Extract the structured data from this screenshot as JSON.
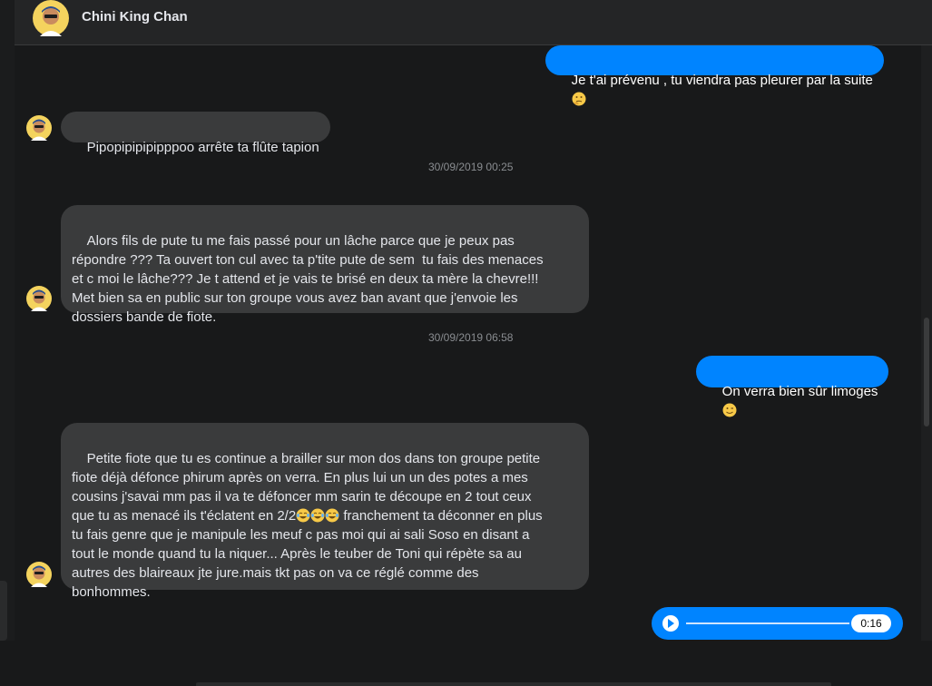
{
  "header": {
    "contact_name": "Chini King Chan"
  },
  "messages": [
    {
      "kind": "outgoing",
      "text": "Je t'ai prévenu , tu viendra pas pleurer par la suite",
      "emoji": "thinking-face"
    },
    {
      "kind": "incoming",
      "text": "Pipopipipipipppoo arrête ta flûte tapion"
    },
    {
      "kind": "timestamp",
      "text": "30/09/2019 00:25"
    },
    {
      "kind": "incoming",
      "text": "Alors fils de pute tu me fais passé pour un lâche parce que je peux pas\nrépondre ??? Ta ouvert ton cul avec ta p'tite pute de sem  tu fais des menaces\net c moi le lâche??? Je t attend et je vais te brisé en deux ta mère la chevre!!!\nMet bien sa en public sur ton groupe vous avez ban avant que j'envoie les\ndossiers bande de fiote."
    },
    {
      "kind": "timestamp",
      "text": "30/09/2019 06:58"
    },
    {
      "kind": "outgoing",
      "text": "On verra bien sûr limoges",
      "emoji": "winking-face"
    },
    {
      "kind": "incoming",
      "text_before": "Petite fiote que tu es continue a brailler sur mon dos dans ton groupe petite\nfiote déjà défonce phirum après on verra. En plus lui un un des potes a mes\ncousins j'savai mm pas il va te défoncer mm sarin te découpe en 2 tout ceux\nque tu as menacé ils t'éclatent en 2/2",
      "text_after": " franchement ta déconner en plus\ntu fais genre que je manipule les meuf c pas moi qui ai sali Soso en disant a\ntout le monde quand tu la niquer... Après le teuber de Toni qui répète sa au\nautres des blaireaux jte jure.mais tkt pas on va ce réglé comme des\nbonhommes.",
      "emoji": "tears-of-joy-face ×3"
    },
    {
      "kind": "audio",
      "duration": "0:16"
    }
  ],
  "colors": {
    "background": "#18191a",
    "incoming_bubble": "#3a3b3c",
    "outgoing_bubble": "#0084ff",
    "timestamp": "#8a8d91"
  }
}
